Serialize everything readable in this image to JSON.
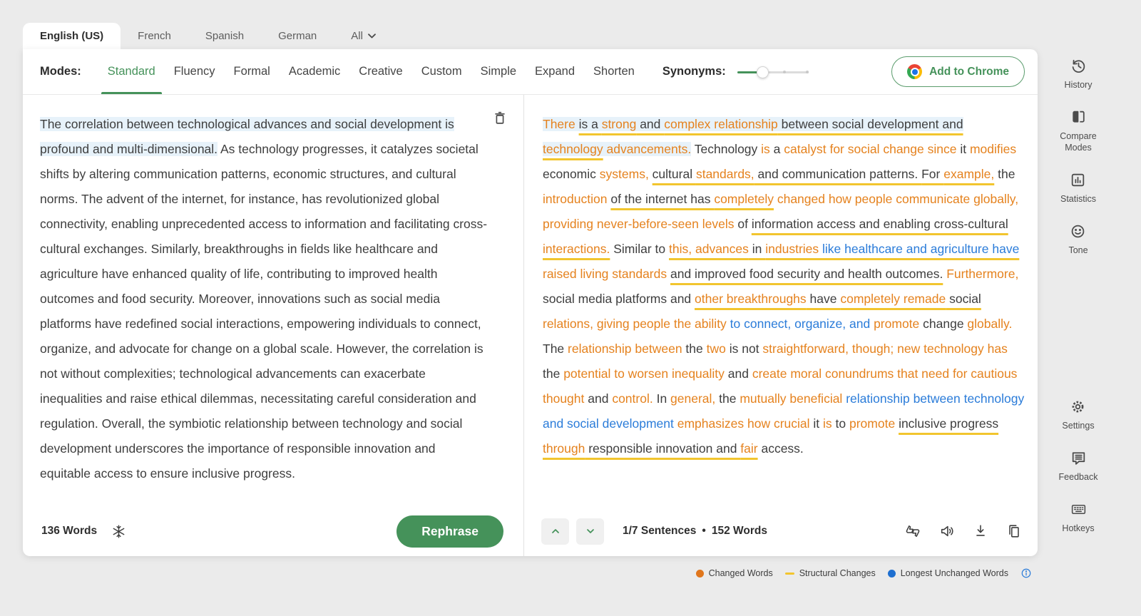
{
  "colors": {
    "accent_green": "#45925a",
    "changed_orange": "#e5821e",
    "structural_yellow": "#f2c52e",
    "unchanged_blue": "#2b7cd9",
    "sentence_highlight": "#e7f2fa"
  },
  "language_tabs": {
    "items": [
      {
        "label": "English (US)",
        "active": true
      },
      {
        "label": "French",
        "active": false
      },
      {
        "label": "Spanish",
        "active": false
      },
      {
        "label": "German",
        "active": false
      },
      {
        "label": "All",
        "active": false,
        "has_chevron": true
      }
    ]
  },
  "toolbar": {
    "modes_label": "Modes:",
    "modes": [
      {
        "label": "Standard",
        "active": true
      },
      {
        "label": "Fluency",
        "active": false
      },
      {
        "label": "Formal",
        "active": false
      },
      {
        "label": "Academic",
        "active": false
      },
      {
        "label": "Creative",
        "active": false
      },
      {
        "label": "Custom",
        "active": false
      },
      {
        "label": "Simple",
        "active": false
      },
      {
        "label": "Expand",
        "active": false
      },
      {
        "label": "Shorten",
        "active": false
      }
    ],
    "synonyms_label": "Synonyms:",
    "synonyms_pct": 35,
    "add_to_chrome_label": "Add to Chrome"
  },
  "input_panel": {
    "highlighted_sentence": "The correlation between technological advances and social development is profound and multi-dimensional.",
    "body_text": " As technology progresses, it catalyzes societal shifts by altering communication patterns, economic structures, and cultural norms. The advent of the internet, for instance, has revolutionized global connectivity, enabling unprecedented access to information and facilitating cross-cultural exchanges. Similarly, breakthroughs in fields like healthcare and agriculture have enhanced quality of life, contributing to improved health outcomes and food security. Moreover, innovations such as social media platforms have redefined social interactions, empowering individuals to connect, organize, and advocate for change on a global scale. However, the correlation is not without complexities; technological advancements can exacerbate inequalities and raise ethical dilemmas, necessitating careful consideration and regulation. Overall, the symbiotic relationship between technology and social development underscores the importance of responsible innovation and equitable access to ensure inclusive progress.",
    "word_count": "136 Words",
    "rephrase_label": "Rephrase"
  },
  "output_panel": {
    "sentence_counter": "1/7 Sentences",
    "separator": "•",
    "word_count": "152 Words",
    "segments": [
      {
        "t": "There ",
        "c": "o",
        "h": true
      },
      {
        "t": "is a ",
        "c": "d",
        "u": true,
        "h": true
      },
      {
        "t": "strong",
        "c": "o",
        "u": true,
        "h": true
      },
      {
        "t": " and ",
        "c": "d",
        "u": true,
        "h": true
      },
      {
        "t": "complex relationship",
        "c": "o",
        "u": true,
        "h": true
      },
      {
        "t": " between social development and ",
        "c": "d",
        "u": true,
        "h": true
      },
      {
        "t": "technology",
        "c": "o",
        "u": true,
        "h": true
      },
      {
        "t": " advancements.",
        "c": "o",
        "h": true
      },
      {
        "t": " Technology ",
        "c": "d"
      },
      {
        "t": "is",
        "c": "o"
      },
      {
        "t": " a ",
        "c": "d"
      },
      {
        "t": "catalyst for social change since",
        "c": "o"
      },
      {
        "t": " it ",
        "c": "d"
      },
      {
        "t": "modifies",
        "c": "o"
      },
      {
        "t": " economic ",
        "c": "d"
      },
      {
        "t": "systems, ",
        "c": "o"
      },
      {
        "t": "cultural ",
        "c": "d",
        "u": true
      },
      {
        "t": "standards,",
        "c": "o",
        "u": true
      },
      {
        "t": " and communication patterns. ",
        "c": "d",
        "u": true
      },
      {
        "t": "For ",
        "c": "d",
        "u": true
      },
      {
        "t": "example,",
        "c": "o",
        "u": true
      },
      {
        "t": " the ",
        "c": "d"
      },
      {
        "t": "introduction ",
        "c": "o"
      },
      {
        "t": "of the internet has ",
        "c": "d",
        "u": true
      },
      {
        "t": "completely",
        "c": "o",
        "u": true
      },
      {
        "t": " changed how people communicate globally, providing never-before-seen levels",
        "c": "o"
      },
      {
        "t": " of ",
        "c": "d"
      },
      {
        "t": "information access and enabling cross-cultural ",
        "c": "d",
        "u": true
      },
      {
        "t": "interactions.",
        "c": "o",
        "u": true
      },
      {
        "t": " Similar to ",
        "c": "d"
      },
      {
        "t": "this, advances",
        "c": "o",
        "u": true
      },
      {
        "t": " in ",
        "c": "d",
        "u": true
      },
      {
        "t": "industries ",
        "c": "o",
        "u": true
      },
      {
        "t": "like healthcare and agriculture have",
        "c": "b",
        "u": true
      },
      {
        "t": " ",
        "c": "d"
      },
      {
        "t": "raised living standards",
        "c": "o"
      },
      {
        "t": " ",
        "c": "d"
      },
      {
        "t": "and improved food security and health outcomes.",
        "c": "d",
        "u": true
      },
      {
        "t": " ",
        "c": "d"
      },
      {
        "t": "Furthermore,",
        "c": "o"
      },
      {
        "t": " social media platforms and ",
        "c": "d"
      },
      {
        "t": "other breakthroughs",
        "c": "o",
        "u": true
      },
      {
        "t": " have ",
        "c": "d",
        "u": true
      },
      {
        "t": "completely remade",
        "c": "o",
        "u": true
      },
      {
        "t": " social",
        "c": "d",
        "u": true
      },
      {
        "t": " ",
        "c": "d"
      },
      {
        "t": "relations, giving people the ability ",
        "c": "o"
      },
      {
        "t": "to connect, organize, and",
        "c": "b"
      },
      {
        "t": " ",
        "c": "d"
      },
      {
        "t": "promote",
        "c": "o"
      },
      {
        "t": " change ",
        "c": "d"
      },
      {
        "t": "globally.",
        "c": "o"
      },
      {
        "t": " The ",
        "c": "d"
      },
      {
        "t": "relationship between",
        "c": "o"
      },
      {
        "t": " the ",
        "c": "d"
      },
      {
        "t": "two",
        "c": "o"
      },
      {
        "t": " is not ",
        "c": "d"
      },
      {
        "t": "straightforward, though; new technology has",
        "c": "o"
      },
      {
        "t": " the ",
        "c": "d"
      },
      {
        "t": "potential to worsen inequality",
        "c": "o"
      },
      {
        "t": " and ",
        "c": "d"
      },
      {
        "t": "create moral conundrums that need for cautious thought",
        "c": "o"
      },
      {
        "t": " and ",
        "c": "d"
      },
      {
        "t": "control.",
        "c": "o"
      },
      {
        "t": " In ",
        "c": "d"
      },
      {
        "t": "general,",
        "c": "o"
      },
      {
        "t": " the ",
        "c": "d"
      },
      {
        "t": "mutually beneficial",
        "c": "o"
      },
      {
        "t": " ",
        "c": "d"
      },
      {
        "t": "relationship between technology and social development",
        "c": "b"
      },
      {
        "t": " ",
        "c": "d"
      },
      {
        "t": "emphasizes how crucial",
        "c": "o"
      },
      {
        "t": " it ",
        "c": "d"
      },
      {
        "t": "is",
        "c": "o"
      },
      {
        "t": " to ",
        "c": "d"
      },
      {
        "t": "promote",
        "c": "o"
      },
      {
        "t": " ",
        "c": "d"
      },
      {
        "t": "inclusive progress ",
        "c": "d",
        "u": true
      },
      {
        "t": "through",
        "c": "o",
        "u": true
      },
      {
        "t": " responsible innovation and ",
        "c": "d",
        "u": true
      },
      {
        "t": "fair",
        "c": "o",
        "u": true
      },
      {
        "t": " access.",
        "c": "d"
      }
    ]
  },
  "sidebar": {
    "items": [
      {
        "label": "History",
        "icon": "history",
        "group": "top"
      },
      {
        "label": "Compare Modes",
        "icon": "compare",
        "group": "top"
      },
      {
        "label": "Statistics",
        "icon": "statistics",
        "group": "top"
      },
      {
        "label": "Tone",
        "icon": "tone",
        "group": "top"
      },
      {
        "label": "Settings",
        "icon": "settings",
        "group": "bottom"
      },
      {
        "label": "Feedback",
        "icon": "feedback",
        "group": "bottom"
      },
      {
        "label": "Hotkeys",
        "icon": "hotkeys",
        "group": "bottom"
      }
    ]
  },
  "legend": {
    "items": [
      {
        "label": "Changed Words",
        "shape": "dot",
        "color": "#e0761c"
      },
      {
        "label": "Structural Changes",
        "shape": "dash",
        "color": "#f2c52e"
      },
      {
        "label": "Longest Unchanged Words",
        "shape": "dot",
        "color": "#1e6fd0"
      }
    ]
  }
}
